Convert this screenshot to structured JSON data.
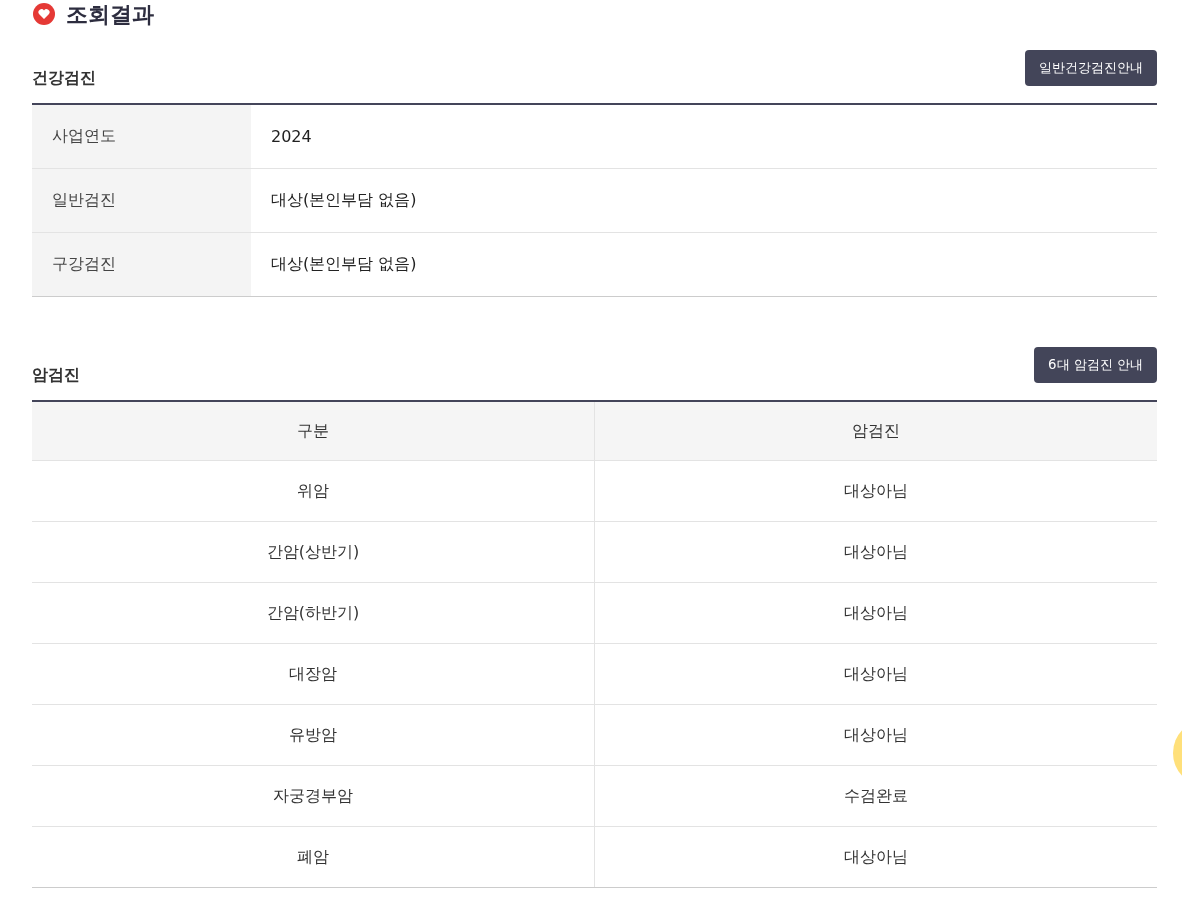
{
  "page_title": "조회결과",
  "health_checkup": {
    "heading": "건강검진",
    "guide_button": "일반건강검진안내",
    "rows": [
      {
        "label": "사업연도",
        "value": "2024"
      },
      {
        "label": "일반검진",
        "value": "대상(본인부담 없음)"
      },
      {
        "label": "구강검진",
        "value": "대상(본인부담 없음)"
      }
    ]
  },
  "cancer_screening": {
    "heading": "암검진",
    "guide_button": "6대 암검진 안내",
    "columns": [
      "구분",
      "암검진"
    ],
    "rows": [
      [
        "위암",
        "대상아님"
      ],
      [
        "간암(상반기)",
        "대상아님"
      ],
      [
        "간암(하반기)",
        "대상아님"
      ],
      [
        "대장암",
        "대상아님"
      ],
      [
        "유방암",
        "대상아님"
      ],
      [
        "자궁경부암",
        "수검완료"
      ],
      [
        "폐암",
        "대상아님"
      ]
    ]
  }
}
